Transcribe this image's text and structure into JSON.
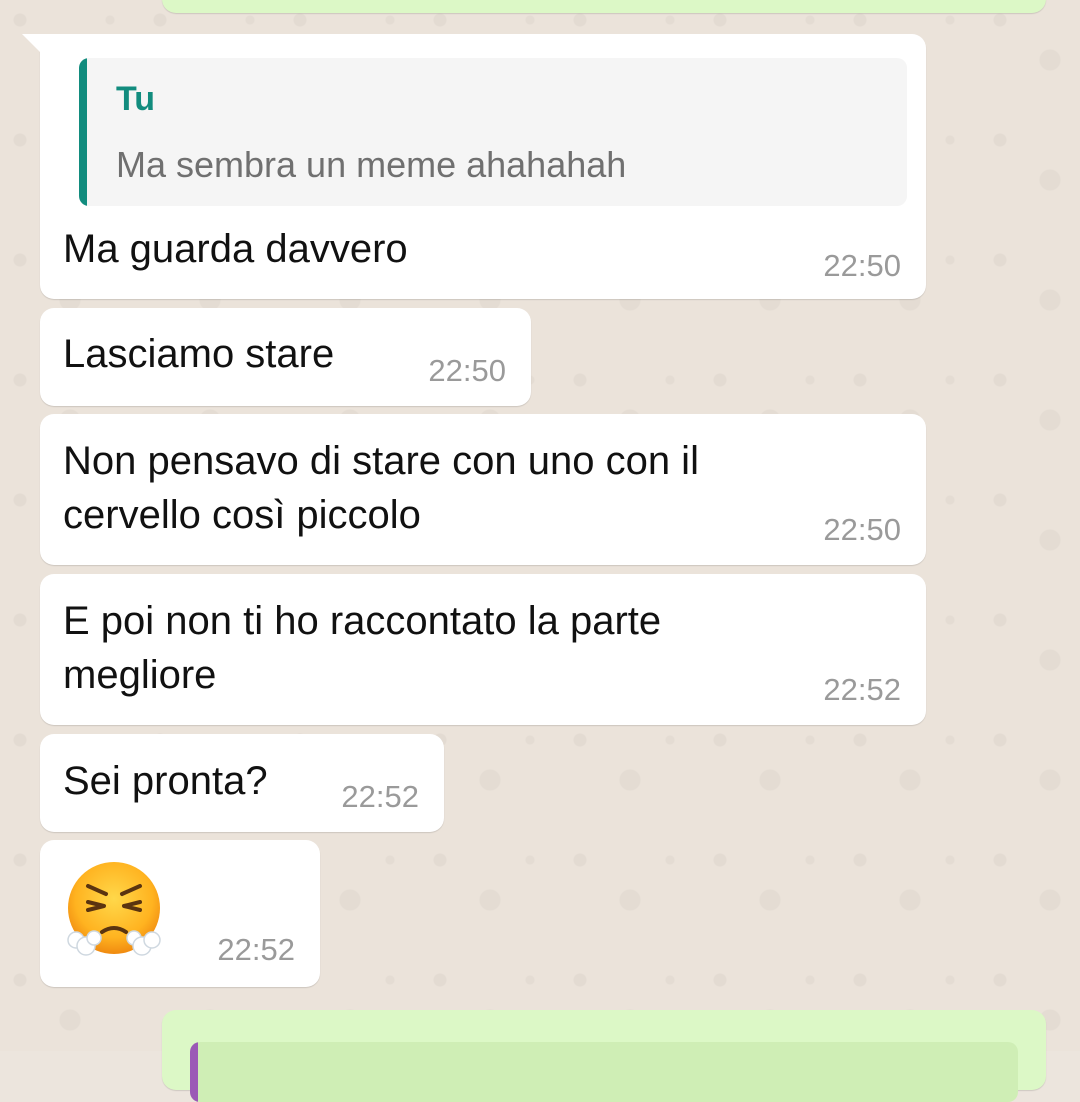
{
  "messages": [
    {
      "quote": {
        "author": "Tu",
        "text": "Ma sembra un meme ahahahah"
      },
      "text": "Ma guarda davvero",
      "time": "22:50"
    },
    {
      "text": "Lasciamo stare",
      "time": "22:50"
    },
    {
      "text": "Non pensavo di stare con uno con il\ncervello così piccolo",
      "time": "22:50"
    },
    {
      "text": "E poi non ti ho raccontato la parte\nmegliore",
      "time": "22:52"
    },
    {
      "text": "Sei pronta?",
      "time": "22:52"
    },
    {
      "emoji": "face-with-steam-from-nose",
      "time": "22:52"
    }
  ],
  "colors": {
    "incoming_bubble": "#ffffff",
    "outgoing_bubble": "#dcf8c6",
    "quote_accent": "#128c7e",
    "timestamp": "#9a9a9a",
    "wallpaper": "#ebe3da"
  }
}
